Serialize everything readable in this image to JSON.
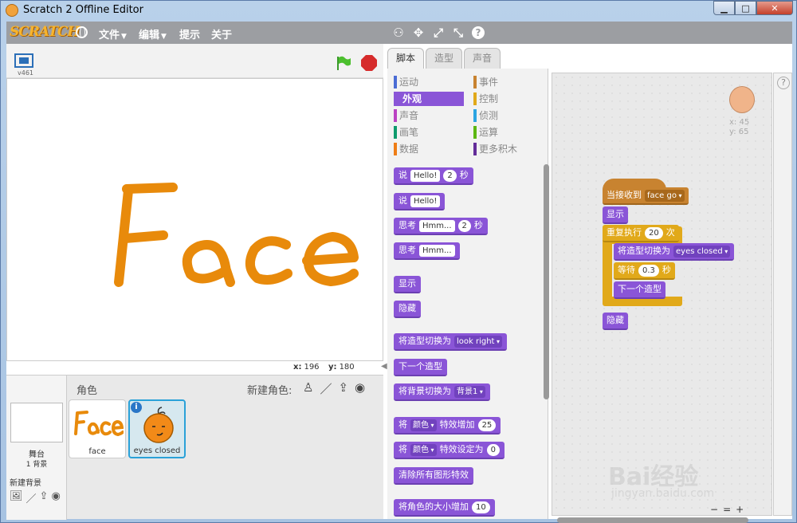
{
  "window": {
    "title": "Scratch 2 Offline Editor",
    "minimize": "▁",
    "maximize": "□",
    "close": "✕"
  },
  "menubar": {
    "logo": "SCRATCH",
    "items": [
      {
        "label": "文件",
        "has_caret": true
      },
      {
        "label": "编辑",
        "has_caret": true
      },
      {
        "label": "提示"
      },
      {
        "label": "关于"
      }
    ],
    "tool_icons": [
      "stamp-icon",
      "cut-icon",
      "grow-icon",
      "shrink-icon",
      "help-icon"
    ]
  },
  "stage": {
    "version": "v461",
    "drawing_text": "Face",
    "drawing_color": "#e88a0b",
    "coords": {
      "x_label": "x:",
      "x": "196",
      "y_label": "y:",
      "y": "180"
    }
  },
  "sprite_pane": {
    "title": "角色",
    "new_sprite_label": "新建角色:",
    "stage_label": "舞台",
    "backdrop_count": "1 背景",
    "new_backdrop_label": "新建背景",
    "sprites": [
      {
        "name": "face",
        "selected": false
      },
      {
        "name": "eyes closed",
        "selected": true
      }
    ]
  },
  "tabs": [
    {
      "label": "脚本",
      "active": true
    },
    {
      "label": "造型"
    },
    {
      "label": "声音"
    }
  ],
  "categories": [
    {
      "label": "运动",
      "color": "#4a6cd4"
    },
    {
      "label": "事件",
      "color": "#c88330"
    },
    {
      "label": "外观",
      "color": "#8a55d7",
      "active": true
    },
    {
      "label": "控制",
      "color": "#e1a91a"
    },
    {
      "label": "声音",
      "color": "#bb42c3"
    },
    {
      "label": "侦测",
      "color": "#2ca5e2"
    },
    {
      "label": "画笔",
      "color": "#0e9a6c"
    },
    {
      "label": "运算",
      "color": "#5cb712"
    },
    {
      "label": "数据",
      "color": "#ee7d16"
    },
    {
      "label": "更多积木",
      "color": "#632d99"
    }
  ],
  "palette_blocks": {
    "say_secs": {
      "a": "说",
      "input": "Hello!",
      "num": "2",
      "b": "秒"
    },
    "say": {
      "a": "说",
      "input": "Hello!"
    },
    "think_secs": {
      "a": "思考",
      "input": "Hmm...",
      "num": "2",
      "b": "秒"
    },
    "think": {
      "a": "思考",
      "input": "Hmm..."
    },
    "show": "显示",
    "hide": "隐藏",
    "switch_costume": {
      "a": "将造型切换为",
      "dd": "look right"
    },
    "next_costume": "下一个造型",
    "switch_backdrop": {
      "a": "将背景切换为",
      "dd": "背景1"
    },
    "change_effect": {
      "a": "将",
      "dd": "颜色",
      "b": "特效增加",
      "num": "25"
    },
    "set_effect": {
      "a": "将",
      "dd": "颜色",
      "b": "特效设定为",
      "num": "0"
    },
    "clear_effects": "清除所有图形特效",
    "change_size": {
      "a": "将角色的大小增加",
      "num": "10"
    }
  },
  "script": {
    "sprite_x": "x: 45",
    "sprite_y": "y: 65",
    "when_receive": {
      "a": "当接收到",
      "dd": "face go"
    },
    "show": "显示",
    "repeat": {
      "a": "重复执行",
      "num": "20",
      "b": "次"
    },
    "switch_costume": {
      "a": "将造型切换为",
      "dd": "eyes closed"
    },
    "wait": {
      "a": "等待",
      "num": "0.3",
      "b": "秒"
    },
    "next_costume": "下一个造型",
    "hide": "隐藏",
    "zoom": [
      "−",
      "=",
      "+"
    ]
  },
  "watermark": {
    "brand": "Bai经验",
    "url": "jingyan.baidu.com"
  }
}
